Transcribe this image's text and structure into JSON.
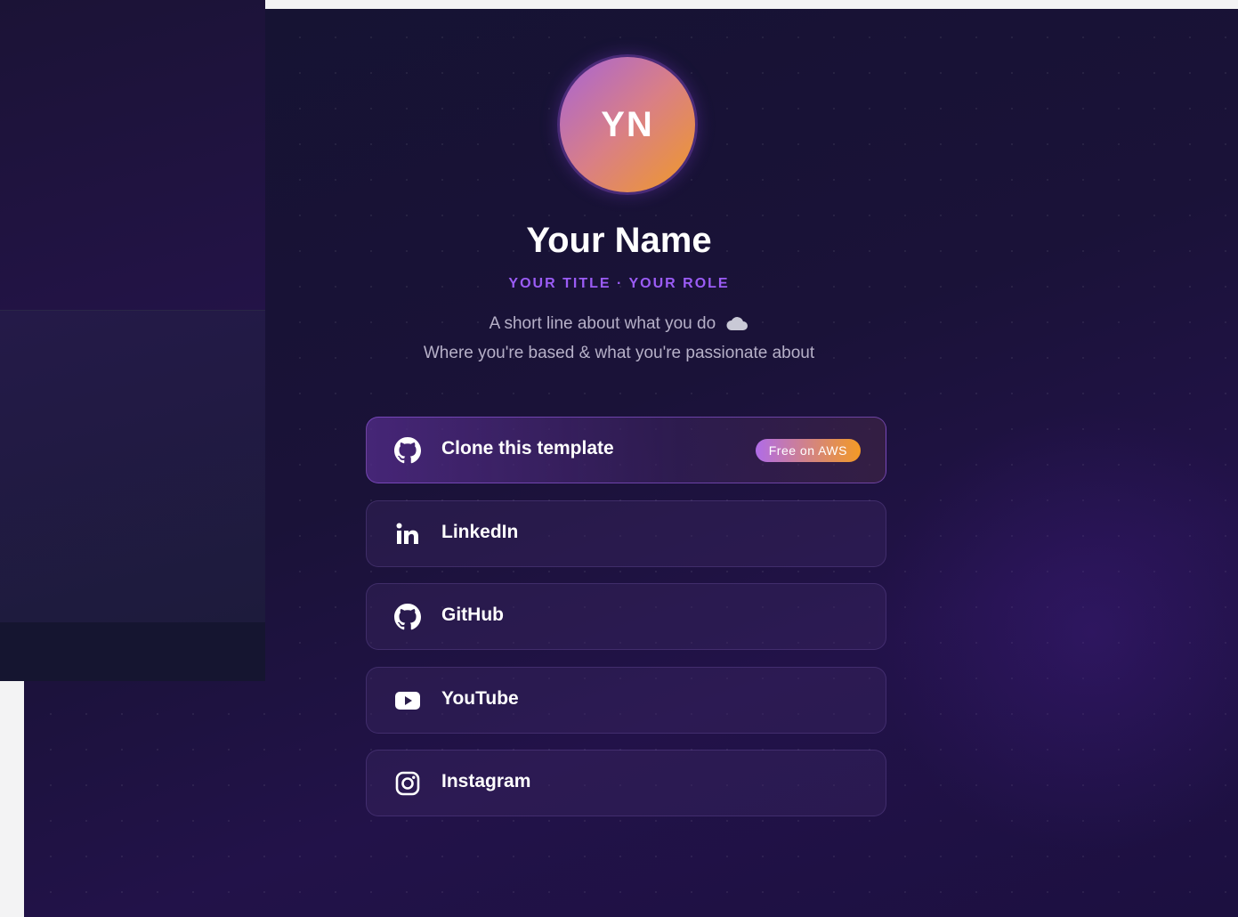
{
  "profile": {
    "initials": "YN",
    "name": "Your Name",
    "role": "YOUR TITLE · YOUR ROLE",
    "bio_line1": "A short line about what you do",
    "bio_line2": "Where you're based & what you're passionate about"
  },
  "links": [
    {
      "label": "Clone this template",
      "icon": "github-icon",
      "badge": "Free on AWS",
      "featured": true
    },
    {
      "label": "LinkedIn",
      "icon": "linkedin-icon"
    },
    {
      "label": "GitHub",
      "icon": "github-icon"
    },
    {
      "label": "YouTube",
      "icon": "youtube-icon"
    },
    {
      "label": "Instagram",
      "icon": "instagram-icon"
    }
  ],
  "colors": {
    "accent": "#9b5cf6",
    "avatar_gradient_start": "#a764d6",
    "avatar_gradient_end": "#f09a26",
    "background": "#1a1238"
  }
}
